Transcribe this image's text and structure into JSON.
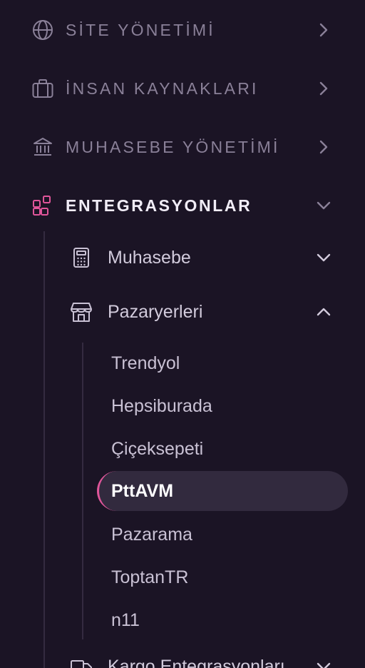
{
  "nav": {
    "sections": [
      {
        "label": "SİTE YÖNETİMİ",
        "icon": "globe-icon"
      },
      {
        "label": "İNSAN KAYNAKLARI",
        "icon": "briefcase-icon"
      },
      {
        "label": "MUHASEBE YÖNETİMİ",
        "icon": "bank-icon"
      },
      {
        "label": "ENTEGRASYONLAR",
        "icon": "apps-add-icon",
        "expanded": true
      }
    ],
    "integrations": {
      "sub_items": [
        {
          "label": "Muhasebe",
          "icon": "calculator-icon",
          "expanded": false
        },
        {
          "label": "Pazaryerleri",
          "icon": "store-icon",
          "expanded": true
        },
        {
          "label": "Kargo Entegrasyonları",
          "icon": "truck-icon",
          "expanded": false
        }
      ],
      "marketplaces": [
        "Trendyol",
        "Hepsiburada",
        "Çiçeksepeti",
        "PttAVM",
        "Pazarama",
        "ToptanTR",
        "n11"
      ],
      "selected_marketplace": "PttAVM"
    }
  },
  "colors": {
    "background": "#1b1425",
    "accent": "#e0559a",
    "muted_text": "#8a8098",
    "active_text": "#f1edf7",
    "selected_bg": "#322a3e"
  }
}
